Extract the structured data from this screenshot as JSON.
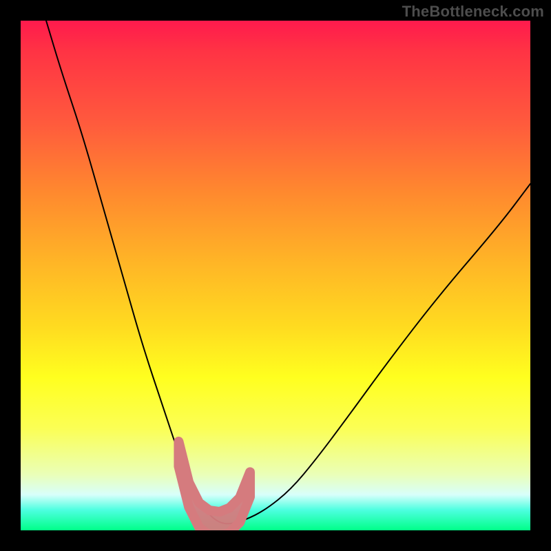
{
  "watermark": "TheBottleneck.com",
  "chart_data": {
    "type": "line",
    "title": "",
    "xlabel": "",
    "ylabel": "",
    "xlim": [
      0,
      100
    ],
    "ylim": [
      0,
      100
    ],
    "grid": false,
    "legend": false,
    "series": [
      {
        "name": "bottleneck-curve",
        "color": "#000000",
        "x": [
          5,
          8,
          12,
          16,
          20,
          24,
          28,
          31,
          33,
          35,
          37,
          39,
          41,
          44,
          48,
          53,
          58,
          64,
          72,
          82,
          94,
          100
        ],
        "y": [
          100,
          90,
          78,
          64,
          50,
          36,
          24,
          15,
          10,
          6,
          3,
          1.5,
          1.2,
          2,
          4,
          8,
          14,
          22,
          33,
          46,
          60,
          68
        ]
      },
      {
        "name": "marker-band",
        "type": "area",
        "color": "#d57b7e",
        "x": [
          31,
          33,
          35,
          37,
          39,
          41,
          43,
          45
        ],
        "y": [
          15,
          7,
          3,
          1.5,
          1.2,
          2,
          4,
          9
        ]
      }
    ],
    "gradient_stops": [
      {
        "pos": 0.0,
        "color": "#ff1a4d"
      },
      {
        "pos": 0.2,
        "color": "#ff5a3d"
      },
      {
        "pos": 0.48,
        "color": "#ffb726"
      },
      {
        "pos": 0.7,
        "color": "#ffff1f"
      },
      {
        "pos": 0.93,
        "color": "#d8fffb"
      },
      {
        "pos": 1.0,
        "color": "#00ff88"
      }
    ]
  }
}
